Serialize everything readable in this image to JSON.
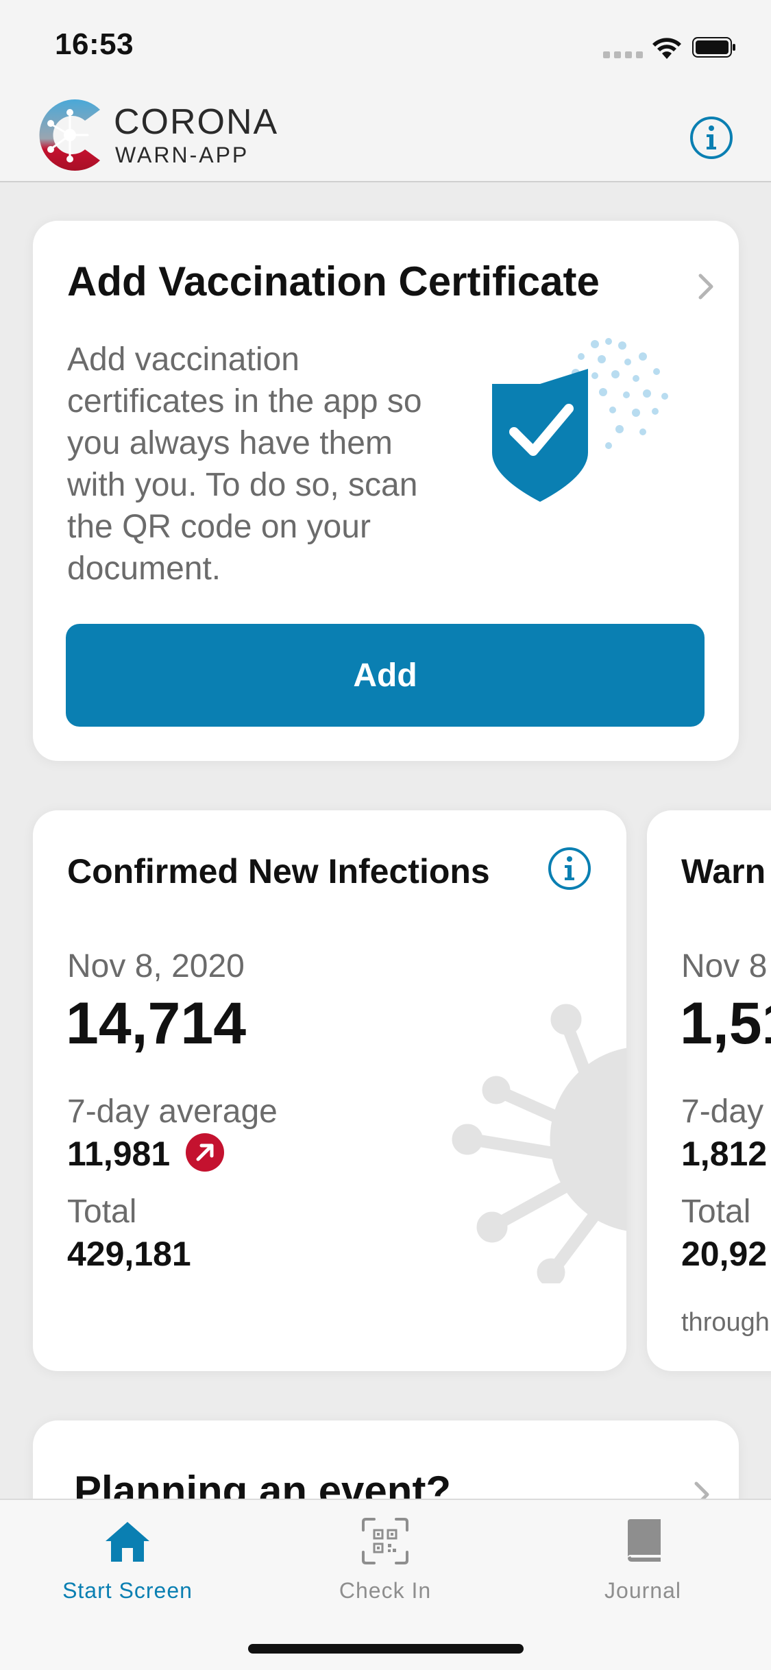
{
  "status_bar": {
    "time": "16:53"
  },
  "header": {
    "logo_title": "CORONA",
    "logo_subtitle": "WARN-APP",
    "info_icon": "info-circle-icon"
  },
  "vaccination_card": {
    "title": "Add Vaccination Certificate",
    "body": "Add vaccination certificates in the app so you always have them with you. To do so, scan the QR code on your document.",
    "button_label": "Add",
    "illustration": "shield-check-icon"
  },
  "statistics": [
    {
      "title": "Confirmed New Infections",
      "date": "Nov 8, 2020",
      "value": "14,714",
      "avg_label": "7-day average",
      "avg_value": "11,981",
      "trend_icon": "trend-up-arrow-icon",
      "total_label": "Total",
      "total_value": "429,181"
    },
    {
      "title": "Warn",
      "date": "Nov 8",
      "value": "1,51",
      "avg_label": "7-day",
      "avg_value": "1,812",
      "total_label": "Total",
      "total_value": "20,92",
      "footnote": "through"
    }
  ],
  "planning_card": {
    "title": "Planning an event?"
  },
  "tabs": [
    {
      "label": "Start Screen",
      "icon": "home-icon",
      "active": true
    },
    {
      "label": "Check In",
      "icon": "qr-code-icon",
      "active": false
    },
    {
      "label": "Journal",
      "icon": "book-icon",
      "active": false
    }
  ],
  "colors": {
    "accent": "#0a7fb2",
    "trend_red": "#c4122f",
    "background": "#ececec"
  }
}
